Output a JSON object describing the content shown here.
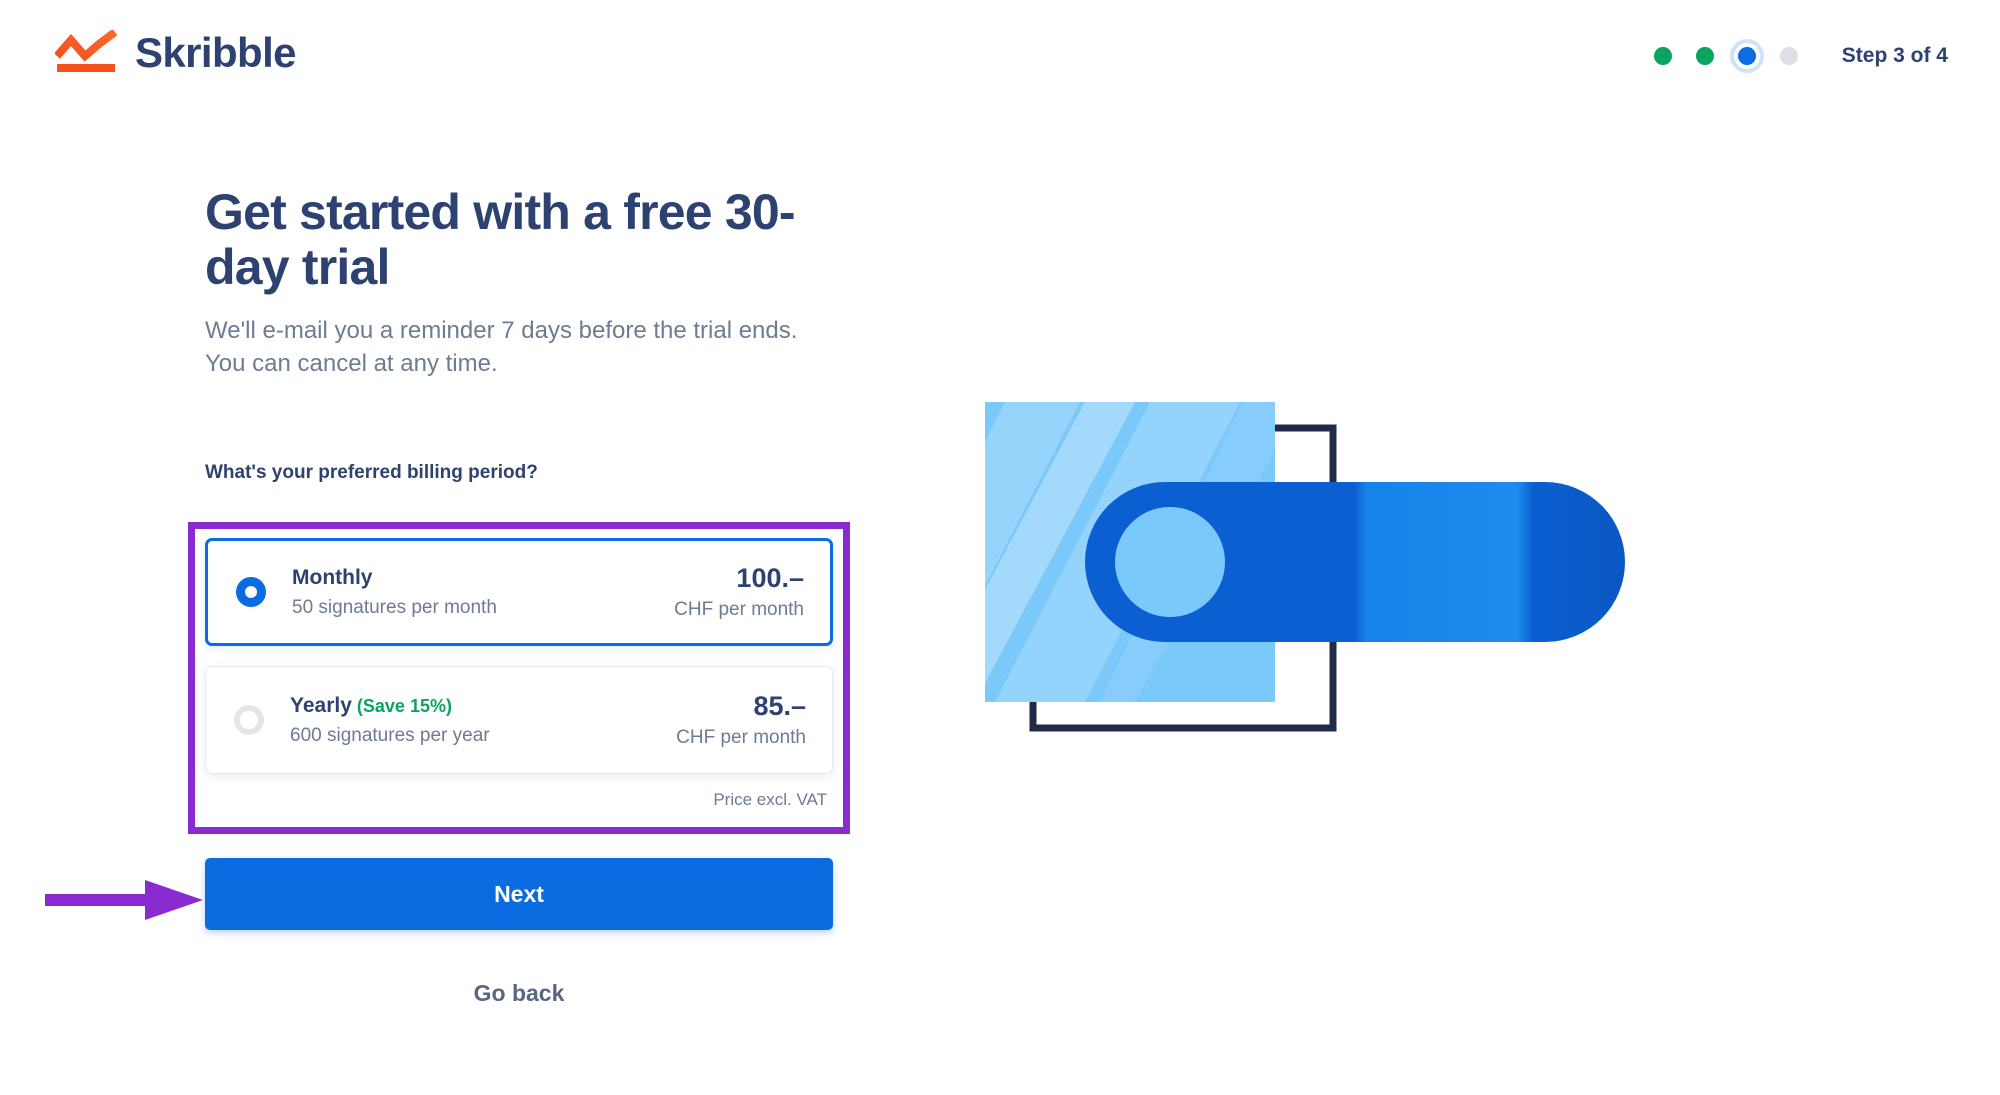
{
  "brand": {
    "name": "Skribble",
    "logo_icon": "skribble-chart-logo-icon",
    "logo_color": "#F4511E",
    "text_color": "#2E4272"
  },
  "header": {
    "step_label": "Step 3 of 4",
    "progress": {
      "current": 3,
      "total": 4,
      "dots": [
        {
          "state": "done",
          "color": "#0BA360"
        },
        {
          "state": "done",
          "color": "#0BA360"
        },
        {
          "state": "active",
          "color": "#0A6CE0"
        },
        {
          "state": "pending",
          "color": "#DCDFE4"
        }
      ]
    }
  },
  "main": {
    "headline": "Get started with a free 30-day trial",
    "subtext": "We'll e-mail you a reminder 7 days before the trial ends. You can cancel at any time.",
    "question": "What's your preferred billing period?",
    "plans": [
      {
        "name": "Monthly",
        "badge": "",
        "sub": "50 signatures per month",
        "price": "100.–",
        "price_unit": "CHF per month",
        "selected": true
      },
      {
        "name": "Yearly",
        "badge": "(Save 15%)",
        "sub": "600 signatures per year",
        "price": "85.–",
        "price_unit": "CHF per month",
        "selected": false
      }
    ],
    "vat_note": "Price excl. VAT",
    "next_label": "Next",
    "goback_label": "Go back"
  },
  "illustration": {
    "name": "toggle-switch-illustration",
    "square_color": "#7BC9FB",
    "outline_color": "#212B45",
    "pill_color": "#0B5FD0",
    "knob_color": "#7BC9FB"
  },
  "annotations": {
    "highlight_color": "#8A2BD2",
    "box_target": "billing-period-options",
    "arrow_target": "next-button"
  }
}
